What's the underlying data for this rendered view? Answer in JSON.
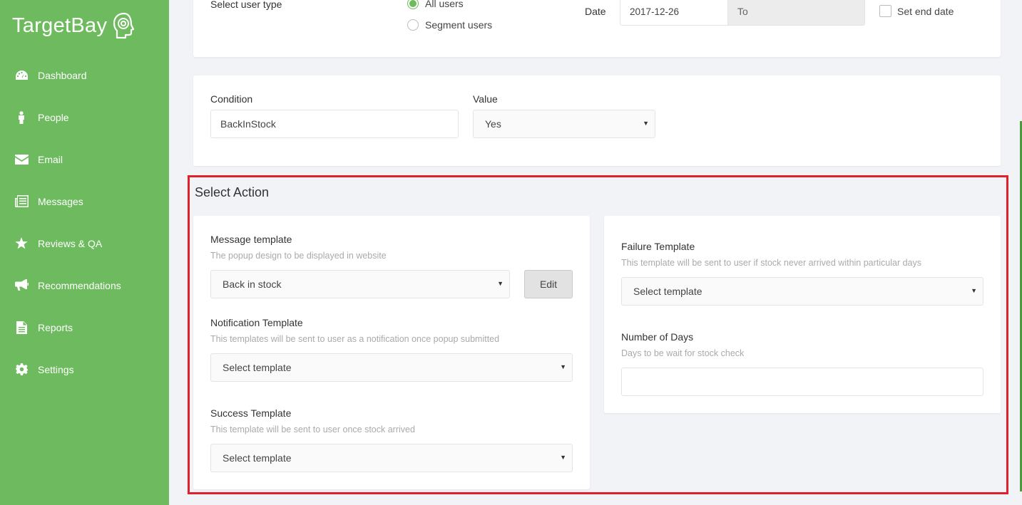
{
  "brand": {
    "name": "TargetBay"
  },
  "sidebar": {
    "items": [
      {
        "label": "Dashboard",
        "icon": "dashboard-icon"
      },
      {
        "label": "People",
        "icon": "person-icon"
      },
      {
        "label": "Email",
        "icon": "envelope-icon"
      },
      {
        "label": "Messages",
        "icon": "messages-icon"
      },
      {
        "label": "Reviews & QA",
        "icon": "star-icon"
      },
      {
        "label": "Recommendations",
        "icon": "megaphone-icon"
      },
      {
        "label": "Reports",
        "icon": "document-icon"
      },
      {
        "label": "Settings",
        "icon": "gear-icon"
      }
    ]
  },
  "top_card": {
    "user_type_label": "Select user type",
    "radio_all": "All users",
    "radio_segment": "Segment users",
    "date_label": "Date",
    "date_value": "2017-12-26",
    "to_placeholder": "To",
    "set_end_date": "Set end date"
  },
  "condition_card": {
    "condition_label": "Condition",
    "condition_value": "BackInStock",
    "value_label": "Value",
    "value_selected": "Yes"
  },
  "select_action": {
    "title": "Select Action",
    "message_template": {
      "label": "Message template",
      "help": "The popup design to be displayed in website",
      "selected": "Back in stock",
      "edit_label": "Edit"
    },
    "notification_template": {
      "label": "Notification Template",
      "help": "This templates will be sent to user as a notification once popup submitted",
      "selected": "Select template"
    },
    "success_template": {
      "label": "Success Template",
      "help": "This template will be sent to user once stock arrived",
      "selected": "Select template"
    },
    "failure_template": {
      "label": "Failure Template",
      "help": "This template will be sent to user if stock never arrived within particular days",
      "selected": "Select template"
    },
    "number_of_days": {
      "label": "Number of Days",
      "help": "Days to be wait for stock check",
      "value": ""
    }
  },
  "colors": {
    "sidebar": "#6dbb5e",
    "highlight": "#e0202b",
    "background": "#f2f3f7"
  }
}
